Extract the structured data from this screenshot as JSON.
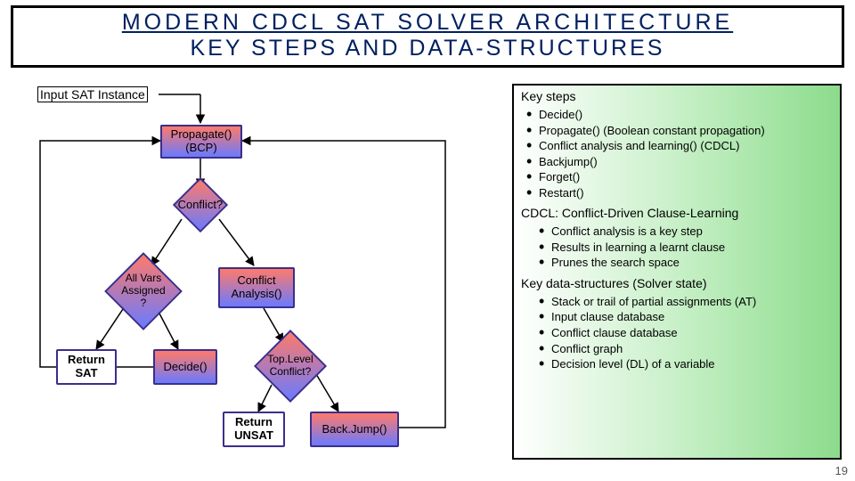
{
  "title": {
    "line1": "MODERN CDCL SAT SOLVER ARCHITECTURE",
    "line2": "KEY STEPS AND DATA-STRUCTURES"
  },
  "input_label": "Input SAT Instance",
  "nodes": {
    "propagate": "Propagate()\n(BCP)",
    "conflict": "Conflict?",
    "allvars": "All Vars\nAssigned\n?",
    "conflict_analysis": "Conflict\nAnalysis()",
    "return_sat": "Return\nSAT",
    "decide": "Decide()",
    "toplevel": "Top.Level\nConflict?",
    "return_unsat": "Return\nUNSAT",
    "backjump": "Back.Jump()"
  },
  "panel": {
    "keysteps_title": "Key steps",
    "keysteps": [
      "Decide()",
      "Propagate() (Boolean constant propagation)",
      "Conflict analysis and learning() (CDCL)",
      "Backjump()",
      "Forget()",
      "Restart()"
    ],
    "cdcl_title": "CDCL: Conflict-Driven Clause-Learning",
    "cdcl_points": [
      "Conflict analysis is a key step",
      "Results in learning a learnt clause",
      "Prunes the search space"
    ],
    "ds_title": "Key data-structures (Solver state)",
    "ds_points": [
      "Stack or trail of partial assignments (AT)",
      "Input clause database",
      "Conflict clause database",
      "Conflict graph",
      "Decision level (DL) of a variable"
    ]
  },
  "page_number": "19",
  "colors": {
    "purple": "#3b2e8c",
    "red": "#c00000",
    "blue": "#2030c0"
  }
}
